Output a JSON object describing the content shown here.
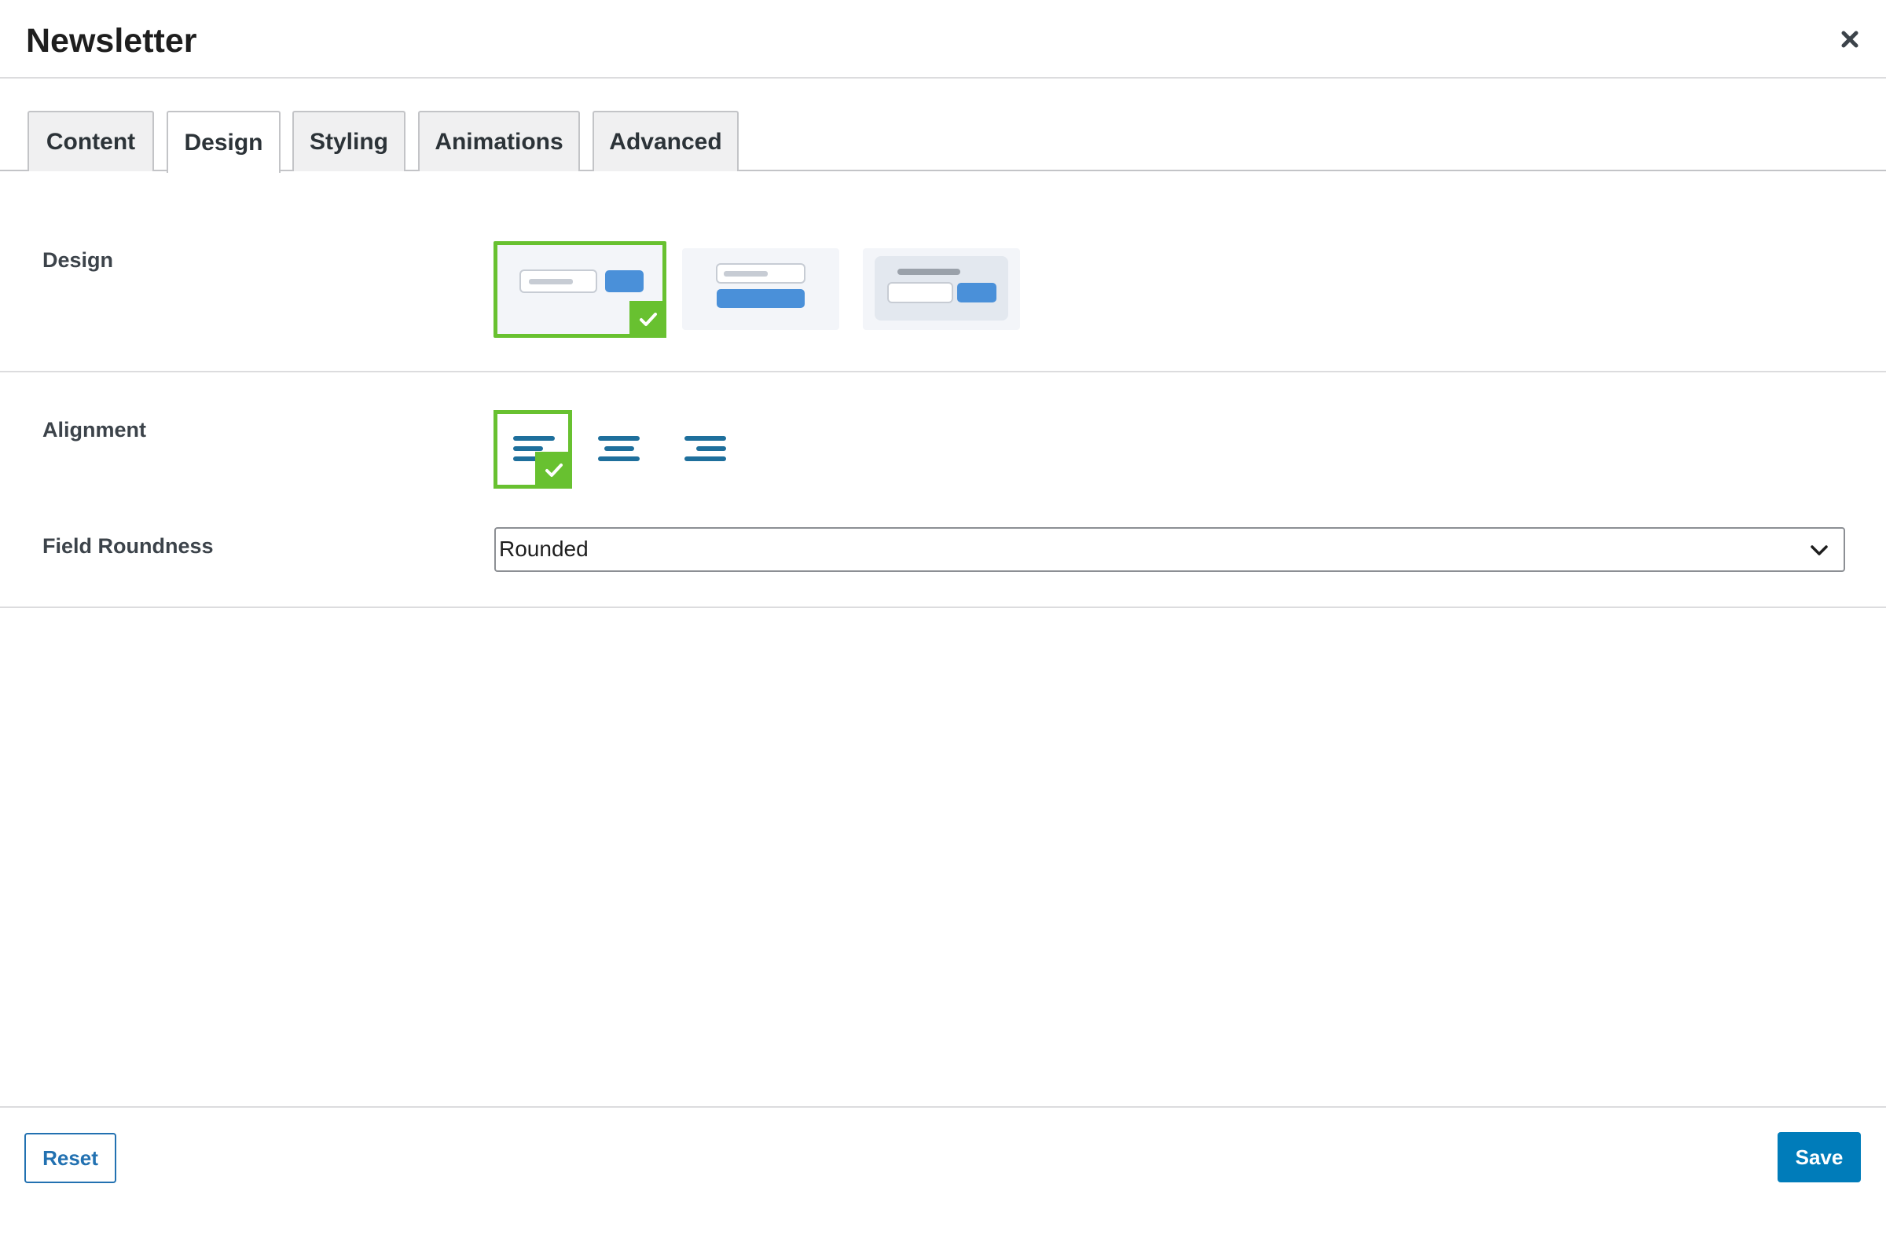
{
  "dialog": {
    "title": "Newsletter",
    "close_icon": "close-icon"
  },
  "tabs": [
    {
      "label": "Content",
      "active": false
    },
    {
      "label": "Design",
      "active": true
    },
    {
      "label": "Styling",
      "active": false
    },
    {
      "label": "Animations",
      "active": false
    },
    {
      "label": "Advanced",
      "active": false
    }
  ],
  "design": {
    "label": "Design",
    "options": [
      {
        "name": "inline-field-button",
        "selected": true
      },
      {
        "name": "stacked-field-button",
        "selected": false
      },
      {
        "name": "boxed-title-field-button",
        "selected": false
      }
    ]
  },
  "alignment": {
    "label": "Alignment",
    "options": [
      {
        "name": "align-left",
        "selected": true
      },
      {
        "name": "align-center",
        "selected": false
      },
      {
        "name": "align-right",
        "selected": false
      }
    ]
  },
  "field_roundness": {
    "label": "Field Roundness",
    "value": "Rounded"
  },
  "footer": {
    "reset_label": "Reset",
    "save_label": "Save"
  },
  "colors": {
    "selected_border": "#68c130",
    "primary": "#007cba",
    "icon_blue": "#1e6f9c",
    "preview_blue": "#4a90d9"
  }
}
